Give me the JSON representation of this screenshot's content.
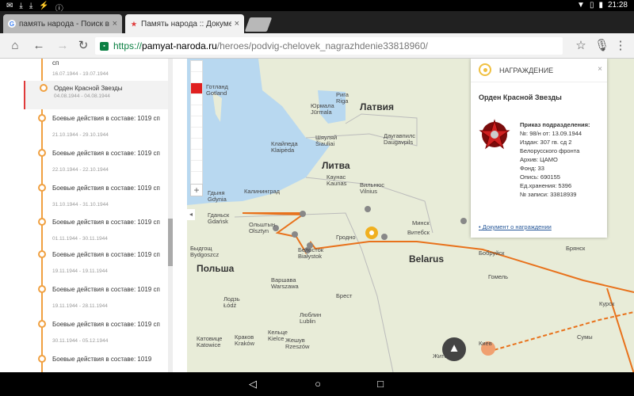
{
  "status_bar": {
    "left_icons": [
      "envelope-icon",
      "download-icon",
      "download-icon",
      "usb-icon",
      "info-icon"
    ],
    "right_icons": [
      "wifi-icon",
      "vibrate-icon",
      "battery-icon"
    ],
    "time": "21:28"
  },
  "tabs": [
    {
      "label": "память народа - Поиск в G",
      "icon": "google-icon",
      "active": false
    },
    {
      "label": "Память народа :: Документ",
      "icon": "star-icon",
      "active": true
    }
  ],
  "url": {
    "scheme": "https://",
    "host": "pamyat-naroda.ru",
    "path": "/heroes/podvig-chelovek_nagrazhdenie33818960/"
  },
  "timeline": {
    "items": [
      {
        "title": "сп",
        "dates": "16.07.1944 - 19.07.1944",
        "active": false
      },
      {
        "title": "Орден Красной Звезды",
        "dates": "04.08.1944 - 04.08.1944",
        "active": true
      },
      {
        "title": "Боевые действия в составе: 1019 сп",
        "dates": "21.10.1944 - 29.10.1944",
        "active": false
      },
      {
        "title": "Боевые действия в составе: 1019 сп",
        "dates": "22.10.1944 - 22.10.1944",
        "active": false
      },
      {
        "title": "Боевые действия в составе: 1019 сп",
        "dates": "31.10.1944 - 31.10.1944",
        "active": false
      },
      {
        "title": "Боевые действия в составе: 1019 сп",
        "dates": "01.11.1944 - 30.11.1944",
        "active": false
      },
      {
        "title": "Боевые действия в составе: 1019 сп",
        "dates": "19.11.1944 - 19.11.1944",
        "active": false
      },
      {
        "title": "Боевые действия в составе: 1019 сп",
        "dates": "19.11.1944 - 28.11.1944",
        "active": false
      },
      {
        "title": "Боевые действия в составе: 1019 сп",
        "dates": "30.11.1944 - 05.12.1944",
        "active": false
      },
      {
        "title": "Боевые действия в составе: 1019",
        "dates": "",
        "active": false
      }
    ]
  },
  "map": {
    "countries": [
      "Латвия",
      "Литва",
      "Польша",
      "Belarus"
    ],
    "cities": [
      {
        "name": "Рига\nRiga"
      },
      {
        "name": "Юрмала\nJūrmala"
      },
      {
        "name": "Даугавпилс\nDaugavpils"
      },
      {
        "name": "Шяуляй\nŠiauliai"
      },
      {
        "name": "Клайпеда\nKlaipėda"
      },
      {
        "name": "Каунас\nKaunas"
      },
      {
        "name": "Вильнюс\nVilnius"
      },
      {
        "name": "Калининград"
      },
      {
        "name": "Гдыня\nGdynia"
      },
      {
        "name": "Гданьск\nGdańsk"
      },
      {
        "name": "Ольштын\nOlsztyn"
      },
      {
        "name": "Быдгощ\nBydgoszcz"
      },
      {
        "name": "Белосток\nBiałystok"
      },
      {
        "name": "Гродно"
      },
      {
        "name": "Минск"
      },
      {
        "name": "Витебск"
      },
      {
        "name": "Бобруйск"
      },
      {
        "name": "Гомель"
      },
      {
        "name": "Варшава\nWarszawa"
      },
      {
        "name": "Лодзь\nŁódź"
      },
      {
        "name": "Брест"
      },
      {
        "name": "Люблин\nLublin"
      },
      {
        "name": "Кельце\nKielce"
      },
      {
        "name": "Катовице\nKatowice"
      },
      {
        "name": "Краков\nKraków"
      },
      {
        "name": "Жешув\nRzeszów"
      },
      {
        "name": "Житомир"
      },
      {
        "name": "Киев"
      },
      {
        "name": "Брянск"
      },
      {
        "name": "Курск"
      },
      {
        "name": "Сумы"
      },
      {
        "name": "Готланд\nGotland"
      }
    ],
    "legend_colors": [
      "#ffffff",
      "#ffffff",
      "#e02020",
      "#ffffff",
      "#ffffff",
      "#ffffff",
      "#ffffff",
      "#ffffff",
      "#ffffff",
      "#ffffff"
    ],
    "zoom_label": "+",
    "collapse_label": "◂"
  },
  "popup": {
    "header": "НАГРАЖДЕНИЕ",
    "close": "×",
    "title": "Орден Красной Звезды",
    "details": [
      {
        "text": "Приказ подразделения:",
        "bold": true
      },
      {
        "text": "№: 98/н от: 13.09.1944",
        "bold": false
      },
      {
        "text": "Издан: 307 гв. сд 2",
        "bold": false
      },
      {
        "text": "Белорусского фронта",
        "bold": false
      },
      {
        "text": "Архив: ЦАМО",
        "bold": false
      },
      {
        "text": "Фонд: 33",
        "bold": false
      },
      {
        "text": "Опись: 690155",
        "bold": false
      },
      {
        "text": "Ед.хранения: 5396",
        "bold": false
      },
      {
        "text": "№ записи: 33818939",
        "bold": false
      }
    ],
    "link": "Документ о награждении",
    "link_bullet": "•"
  },
  "fab_label": "▲",
  "sysnav": {
    "back": "◁",
    "home": "○",
    "recents": "□"
  },
  "colors": {
    "accent": "#f0a040",
    "route": "#e8721c",
    "active_marker": "#e02020",
    "link": "#2a5a9a"
  }
}
